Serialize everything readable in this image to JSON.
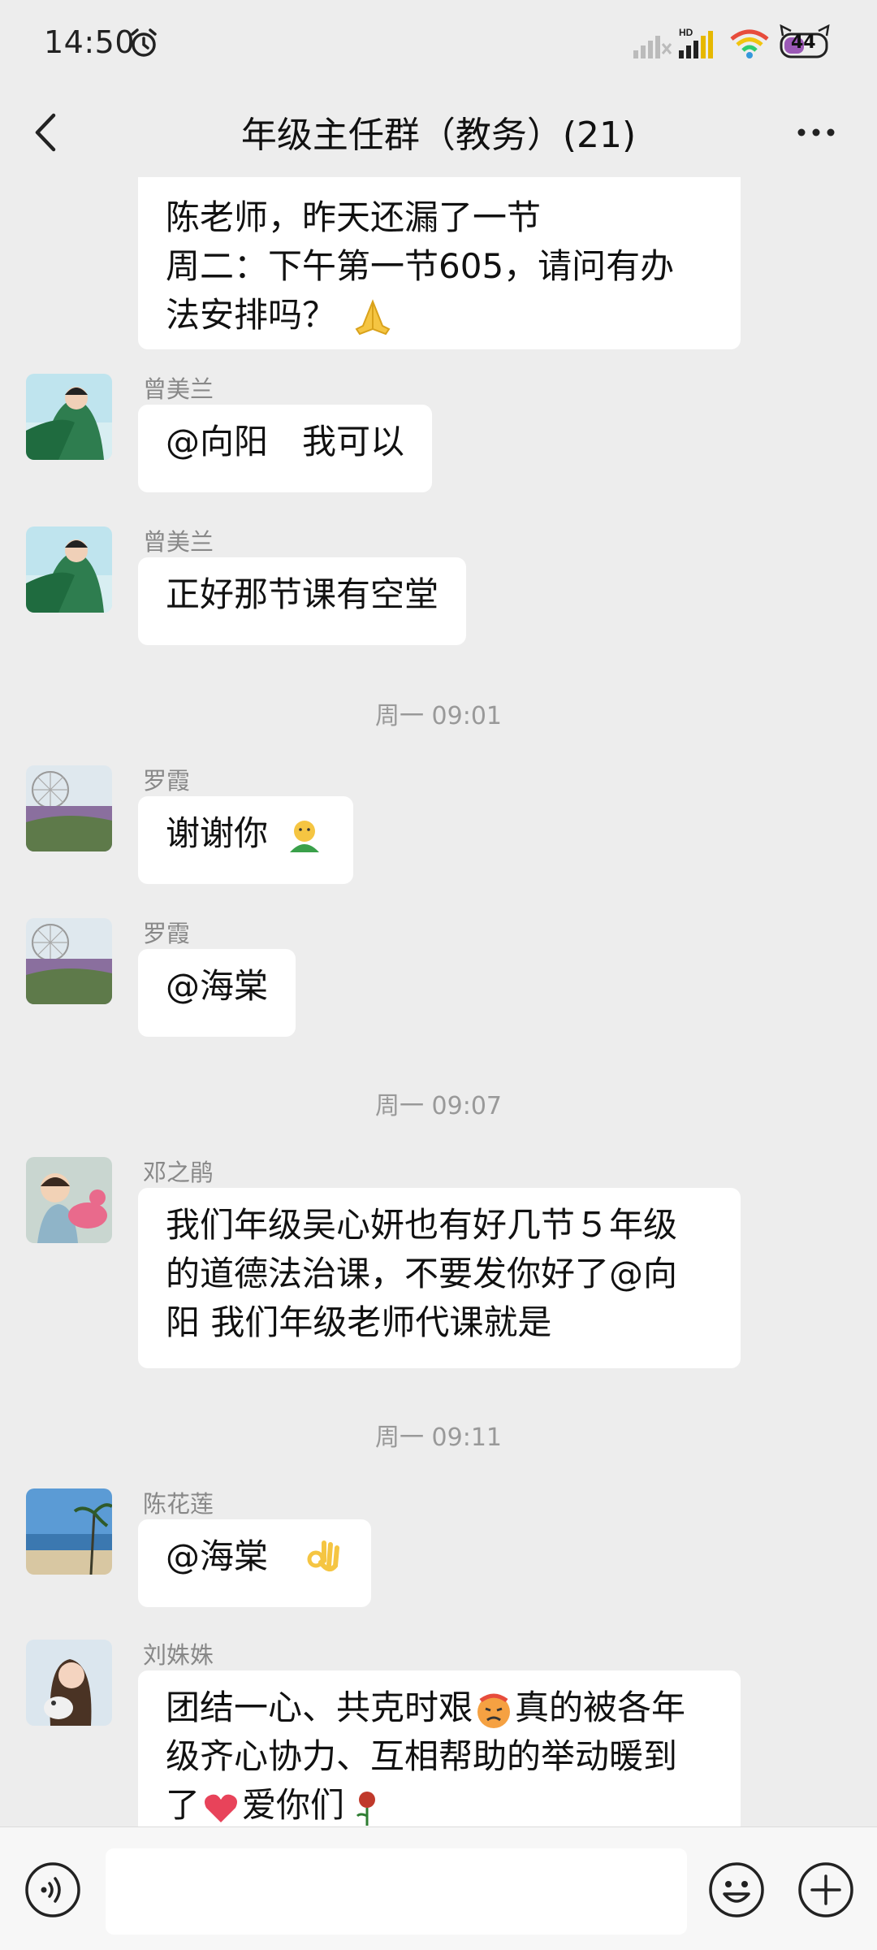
{
  "status_bar": {
    "time": "14:50",
    "battery": "44"
  },
  "header": {
    "title": "年级主任群（教务）(21)"
  },
  "messages": [
    {
      "lines": [
        "陈老师，昨天还漏了一节",
        "周二：下午第一节605，请问有办",
        "法安排吗？"
      ],
      "emoji": "folded-hands"
    },
    {
      "sender": "曾美兰",
      "text": "@向阳　我可以"
    },
    {
      "sender": "曾美兰",
      "text": "正好那节课有空堂"
    },
    {
      "timestamp": "周一 09:01"
    },
    {
      "sender": "罗霞",
      "text": "谢谢你",
      "emoji": "hug"
    },
    {
      "sender": "罗霞",
      "text": "@海棠"
    },
    {
      "timestamp": "周一 09:07"
    },
    {
      "sender": "邓之鹃",
      "lines": [
        "我们年级吴心妍也有好几节５年级",
        "的道德法治课，不要发你好了@向",
        "阳  我们年级老师代课就是"
      ]
    },
    {
      "timestamp": "周一 09:11"
    },
    {
      "sender": "陈花莲",
      "text": "@海棠",
      "emoji": "ok-hand"
    },
    {
      "sender": "刘姝姝",
      "lines": [
        "团结一心、共克时艰",
        "真的被各年",
        "级齐心协力、互相帮助的举动暖到",
        "了",
        "爱你们"
      ],
      "emoji": "heart"
    }
  ],
  "input_bar": {
    "placeholder": ""
  },
  "colors": {
    "background": "#ededed",
    "bubble": "#ffffff",
    "meta_text": "#888888"
  }
}
